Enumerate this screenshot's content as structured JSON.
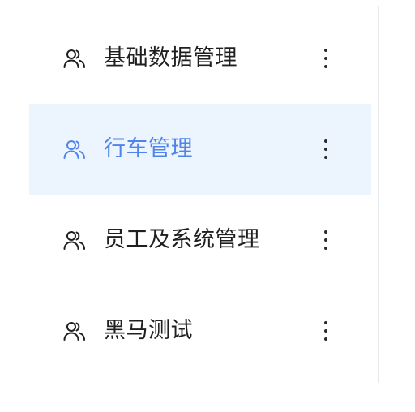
{
  "menu": {
    "items": [
      {
        "label": "基础数据管理",
        "icon": "users-icon",
        "active": false
      },
      {
        "label": "行车管理",
        "icon": "users-icon",
        "active": true
      },
      {
        "label": "员工及系统管理",
        "icon": "users-icon",
        "active": false
      },
      {
        "label": "黑马测试",
        "icon": "users-icon",
        "active": false
      }
    ],
    "more_icon": "more-vertical-icon"
  },
  "colors": {
    "active_text": "#4f84ea",
    "active_background": "#ecf4fe",
    "text": "#1f1f1f",
    "divider": "#e6e8eb"
  }
}
